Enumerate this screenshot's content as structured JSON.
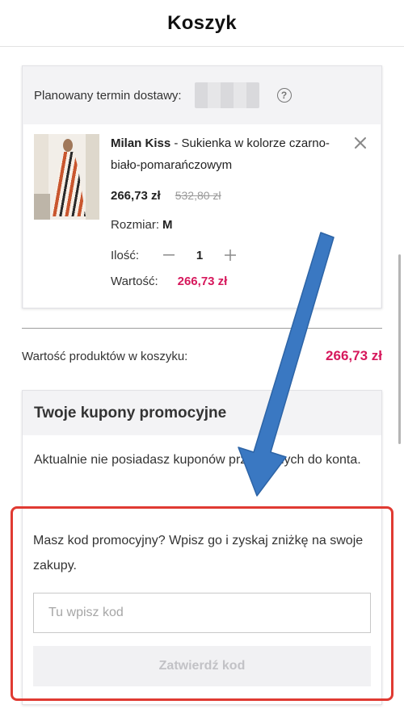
{
  "header": {
    "title": "Koszyk"
  },
  "delivery": {
    "label": "Planowany termin dostawy:",
    "help_icon": "question-circle-icon"
  },
  "product": {
    "brand": "Milan Kiss",
    "description": " - Sukienka w kolorze czarno-biało-pomarańczowym",
    "price_current": "266,73 zł",
    "price_old": "532,80 zł",
    "size_label": "Rozmiar:",
    "size_value": "M",
    "qty_label": "Ilość:",
    "qty_minus": "−",
    "qty_value": "1",
    "qty_plus": "+",
    "value_label": "Wartość:",
    "value_amount": "266,73 zł",
    "remove_icon": "close-icon"
  },
  "summary": {
    "label": "Wartość produktów w koszyku:",
    "value": "266,73 zł"
  },
  "coupons": {
    "title": "Twoje kupony promocyjne",
    "info_text": "Aktualnie nie posiadasz kuponów przypisanych do konta."
  },
  "promo": {
    "text": "Masz kod promocyjny? Wpisz go i zyskaj zniżkę na swoje zakupy.",
    "input_placeholder": "Tu wpisz kod",
    "submit_label": "Zatwierdź kod"
  },
  "colors": {
    "accent_price": "#d6185c",
    "highlight": "#e03a32",
    "arrow": "#3a78c2"
  }
}
